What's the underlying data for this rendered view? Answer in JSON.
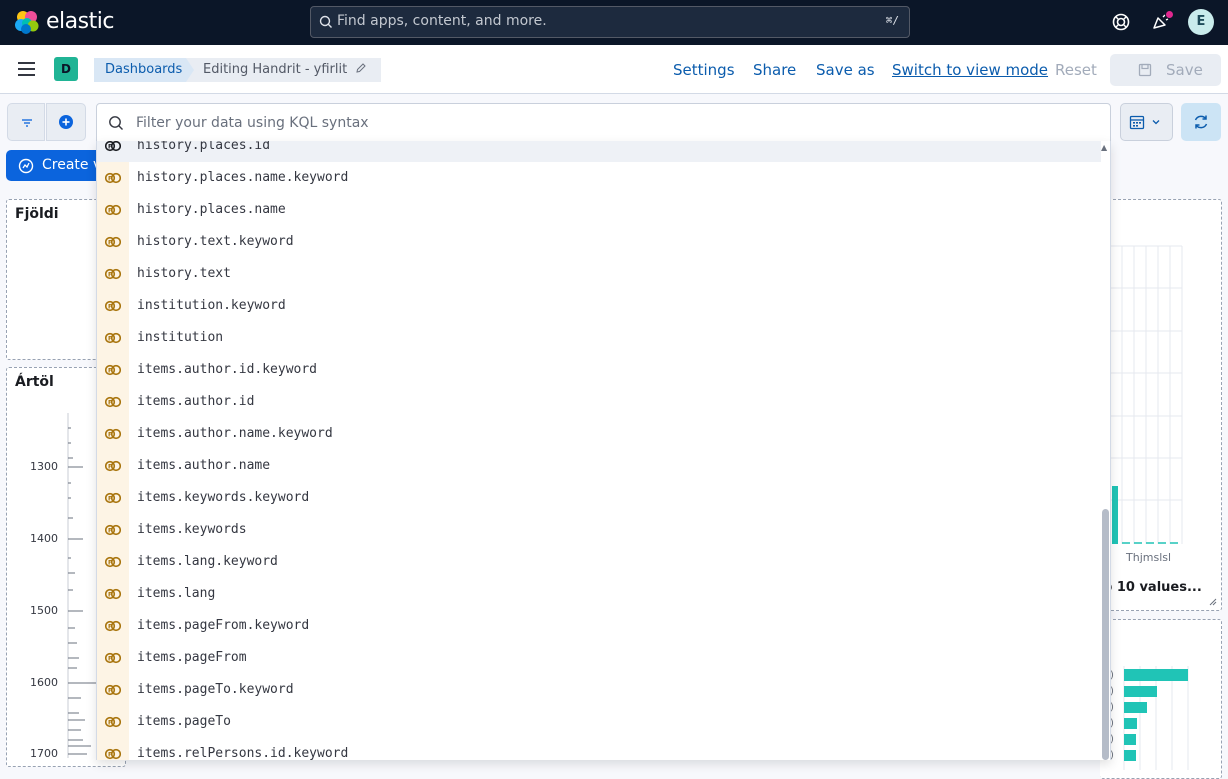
{
  "header": {
    "brand": "elastic",
    "search_placeholder": "Find apps, content, and more.",
    "search_shortcut": "⌘/",
    "avatar_initial": "E"
  },
  "nav": {
    "space_initial": "D",
    "breadcrumbs": [
      "Dashboards",
      "Editing Handrit - yfirlit"
    ],
    "actions": {
      "settings": "Settings",
      "share": "Share",
      "save_as": "Save as",
      "switch_mode": "Switch to view mode",
      "reset": "Reset",
      "save": "Save"
    }
  },
  "query": {
    "placeholder": "Filter your data using KQL syntax"
  },
  "toolbar": {
    "create_label": "Create v"
  },
  "panels": {
    "count_title": "Fjöldi",
    "year_title": "Ártöl",
    "year_ticks": [
      "1300",
      "1400",
      "1500",
      "1600",
      "1700"
    ],
    "right_axis_label": "Thjmslsl",
    "more_values": "p 10 values..."
  },
  "suggestions": [
    {
      "label": "history.places.id",
      "active": true
    },
    {
      "label": "history.places.name.keyword"
    },
    {
      "label": "history.places.name"
    },
    {
      "label": "history.text.keyword"
    },
    {
      "label": "history.text"
    },
    {
      "label": "institution.keyword"
    },
    {
      "label": "institution"
    },
    {
      "label": "items.author.id.keyword"
    },
    {
      "label": "items.author.id"
    },
    {
      "label": "items.author.name.keyword"
    },
    {
      "label": "items.author.name"
    },
    {
      "label": "items.keywords.keyword"
    },
    {
      "label": "items.keywords"
    },
    {
      "label": "items.lang.keyword"
    },
    {
      "label": "items.lang"
    },
    {
      "label": "items.pageFrom.keyword"
    },
    {
      "label": "items.pageFrom"
    },
    {
      "label": "items.pageTo.keyword"
    },
    {
      "label": "items.pageTo"
    },
    {
      "label": "items.relPersons.id.keyword"
    }
  ],
  "colors": {
    "topbar": "#0b1628",
    "link": "#0b5cad",
    "teal_bar": "#20c4b6",
    "field_icon": "#b8860b"
  }
}
